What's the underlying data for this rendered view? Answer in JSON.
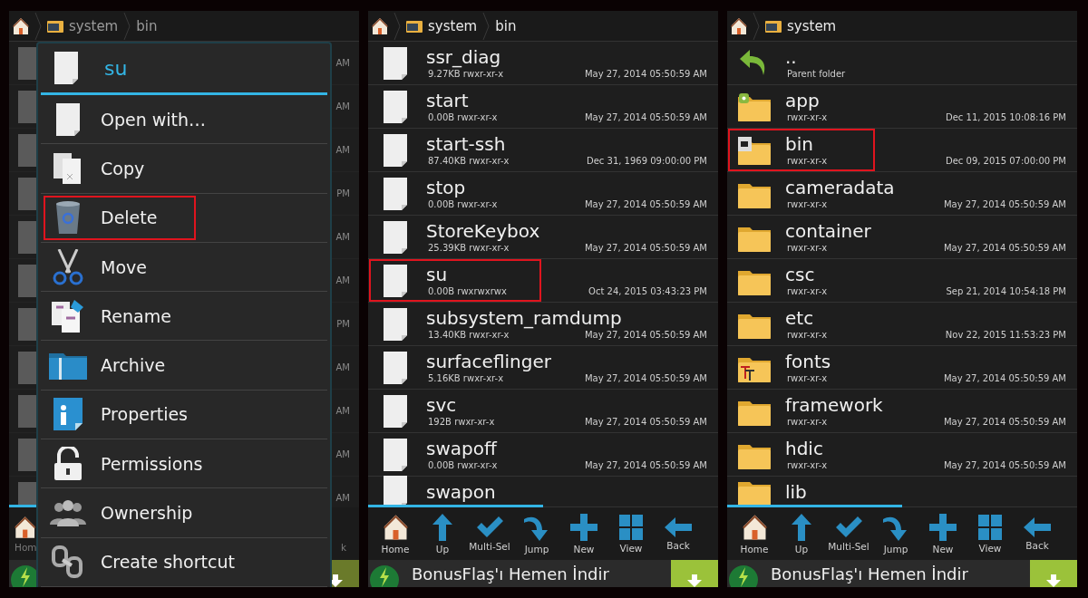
{
  "left_screen": {
    "breadcrumb": [
      "system",
      "bin"
    ],
    "background_rows": [
      {
        "time_suffix": "AM"
      },
      {
        "time_suffix": "AM"
      },
      {
        "time_suffix": "AM"
      },
      {
        "time_suffix": "PM"
      },
      {
        "time_suffix": "AM"
      },
      {
        "time_suffix": "AM"
      },
      {
        "time_suffix": "PM"
      },
      {
        "time_suffix": "AM"
      },
      {
        "time_suffix": "AM"
      },
      {
        "time_suffix": "AM"
      },
      {
        "time_suffix": "AM"
      }
    ],
    "toolbar_fragments": [
      "Hom",
      "k"
    ],
    "dialog": {
      "title": "su",
      "items": [
        {
          "kind": "open",
          "label": "Open with…",
          "highlighted": false
        },
        {
          "kind": "copy",
          "label": "Copy",
          "highlighted": false
        },
        {
          "kind": "delete",
          "label": "Delete",
          "highlighted": true
        },
        {
          "kind": "move",
          "label": "Move",
          "highlighted": false
        },
        {
          "kind": "rename",
          "label": "Rename",
          "highlighted": false
        },
        {
          "kind": "archive",
          "label": "Archive",
          "highlighted": false
        },
        {
          "kind": "properties",
          "label": "Properties",
          "highlighted": false
        },
        {
          "kind": "permissions",
          "label": "Permissions",
          "highlighted": false
        },
        {
          "kind": "ownership",
          "label": "Ownership",
          "highlighted": false
        },
        {
          "kind": "shortcut",
          "label": "Create shortcut",
          "highlighted": false
        }
      ]
    }
  },
  "middle_screen": {
    "breadcrumb": [
      "system",
      "bin"
    ],
    "rows": [
      {
        "kind": "file",
        "name": "ssr_diag",
        "details": "9.27KB rwxr-xr-x",
        "date": "May 27, 2014 05:50:59 AM",
        "highlighted": false
      },
      {
        "kind": "file",
        "name": "start",
        "details": "0.00B rwxr-xr-x",
        "date": "May 27, 2014 05:50:59 AM",
        "highlighted": false
      },
      {
        "kind": "file",
        "name": "start-ssh",
        "details": "87.40KB rwxr-xr-x",
        "date": "Dec 31, 1969 09:00:00 PM",
        "highlighted": false
      },
      {
        "kind": "file",
        "name": "stop",
        "details": "0.00B rwxr-xr-x",
        "date": "May 27, 2014 05:50:59 AM",
        "highlighted": false
      },
      {
        "kind": "file",
        "name": "StoreKeybox",
        "details": "25.39KB rwxr-xr-x",
        "date": "May 27, 2014 05:50:59 AM",
        "highlighted": false
      },
      {
        "kind": "file",
        "name": "su",
        "details": "0.00B rwxrwxrwx",
        "date": "Oct 24, 2015 03:43:23 PM",
        "highlighted": true
      },
      {
        "kind": "file",
        "name": "subsystem_ramdump",
        "details": "13.40KB rwxr-xr-x",
        "date": "May 27, 2014 05:50:59 AM",
        "highlighted": false
      },
      {
        "kind": "file",
        "name": "surfaceflinger",
        "details": "5.16KB rwxr-xr-x",
        "date": "May 27, 2014 05:50:59 AM",
        "highlighted": false
      },
      {
        "kind": "file",
        "name": "svc",
        "details": "192B rwxr-xr-x",
        "date": "May 27, 2014 05:50:59 AM",
        "highlighted": false
      },
      {
        "kind": "file",
        "name": "swapoff",
        "details": "0.00B rwxr-xr-x",
        "date": "May 27, 2014 05:50:59 AM",
        "highlighted": false
      },
      {
        "kind": "file",
        "name": "swapon",
        "highlighted": false
      }
    ],
    "toolbar": [
      {
        "kind": "home",
        "label": "Home"
      },
      {
        "kind": "up",
        "label": "Up"
      },
      {
        "kind": "multi",
        "label": "Multi-Sel"
      },
      {
        "kind": "jump",
        "label": "Jump"
      },
      {
        "kind": "new",
        "label": "New"
      },
      {
        "kind": "view",
        "label": "View"
      },
      {
        "kind": "back",
        "label": "Back"
      }
    ],
    "ad": "BonusFlaş'ı Hemen İndir"
  },
  "right_screen": {
    "breadcrumb": [
      "system"
    ],
    "rows": [
      {
        "kind": "parent",
        "name": "..",
        "details": "Parent folder",
        "highlighted": false
      },
      {
        "kind": "android-folder",
        "name": "app",
        "details": "rwxr-xr-x",
        "date": "Dec 11, 2015 10:08:16 PM",
        "highlighted": false
      },
      {
        "kind": "terminal-folder",
        "name": "bin",
        "details": "rwxr-xr-x",
        "date": "Dec 09, 2015 07:00:00 PM",
        "highlighted": true
      },
      {
        "kind": "folder",
        "name": "cameradata",
        "details": "rwxr-xr-x",
        "date": "May 27, 2014 05:50:59 AM",
        "highlighted": false
      },
      {
        "kind": "folder",
        "name": "container",
        "details": "rwxr-xr-x",
        "date": "May 27, 2014 05:50:59 AM",
        "highlighted": false
      },
      {
        "kind": "folder",
        "name": "csc",
        "details": "rwxr-xr-x",
        "date": "Sep 21, 2014 10:54:18 PM",
        "highlighted": false
      },
      {
        "kind": "folder",
        "name": "etc",
        "details": "rwxr-xr-x",
        "date": "Nov 22, 2015 11:53:23 PM",
        "highlighted": false
      },
      {
        "kind": "fonts-folder",
        "name": "fonts",
        "details": "rwxr-xr-x",
        "date": "May 27, 2014 05:50:59 AM",
        "highlighted": false
      },
      {
        "kind": "folder",
        "name": "framework",
        "details": "rwxr-xr-x",
        "date": "May 27, 2014 05:50:59 AM",
        "highlighted": false
      },
      {
        "kind": "folder",
        "name": "hdic",
        "details": "rwxr-xr-x",
        "date": "May 27, 2014 05:50:59 AM",
        "highlighted": false
      },
      {
        "kind": "folder",
        "name": "lib",
        "highlighted": false
      }
    ],
    "toolbar": [
      {
        "kind": "home",
        "label": "Home"
      },
      {
        "kind": "up",
        "label": "Up"
      },
      {
        "kind": "multi",
        "label": "Multi-Sel"
      },
      {
        "kind": "jump",
        "label": "Jump"
      },
      {
        "kind": "new",
        "label": "New"
      },
      {
        "kind": "view",
        "label": "View"
      },
      {
        "kind": "back",
        "label": "Back"
      }
    ],
    "ad": "BonusFlaş'ı Hemen İndir"
  }
}
